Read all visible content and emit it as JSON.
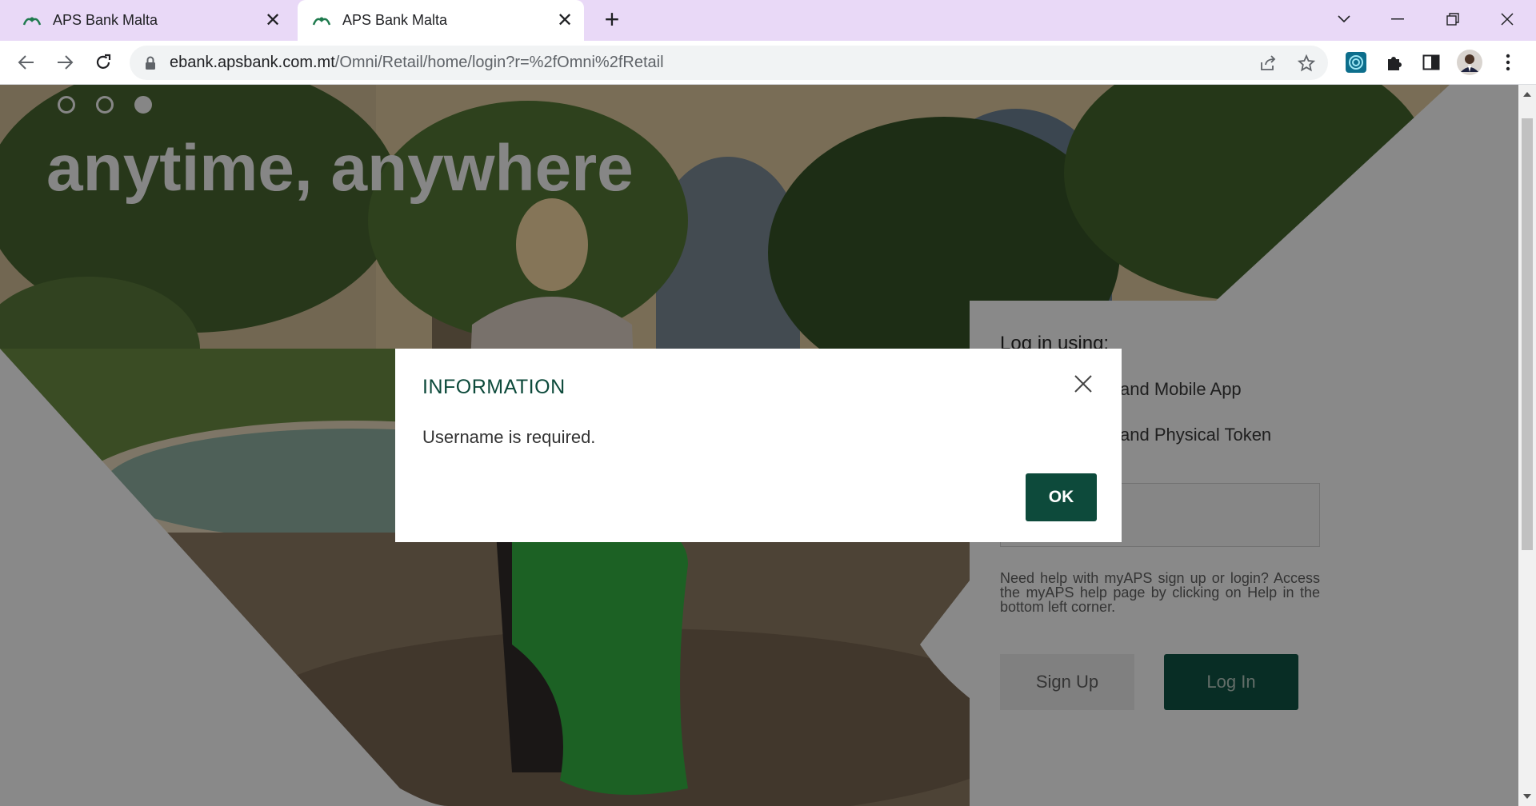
{
  "browser": {
    "tabs": [
      {
        "title": "APS Bank Malta",
        "active": false
      },
      {
        "title": "APS Bank Malta",
        "active": true
      }
    ],
    "address": {
      "host": "ebank.apsbank.com.mt",
      "path": "/Omni/Retail/home/login?r=%2fOmni%2fRetail"
    }
  },
  "page": {
    "slogan": "anytime, anywhere",
    "carousel": {
      "count": 3,
      "active_index": 2
    },
    "login": {
      "title": "Log in using:",
      "options": [
        "and Mobile App",
        "and Physical Token"
      ],
      "help_text": "Need help with myAPS sign up or login? Access the myAPS help page by clicking on Help in the bottom left corner.",
      "signup_label": "Sign Up",
      "login_label": "Log In"
    }
  },
  "modal": {
    "title": "INFORMATION",
    "message": "Username is required.",
    "ok_label": "OK"
  },
  "colors": {
    "brand_green": "#0d4a3b",
    "tabstrip": "#e9d9f7"
  }
}
